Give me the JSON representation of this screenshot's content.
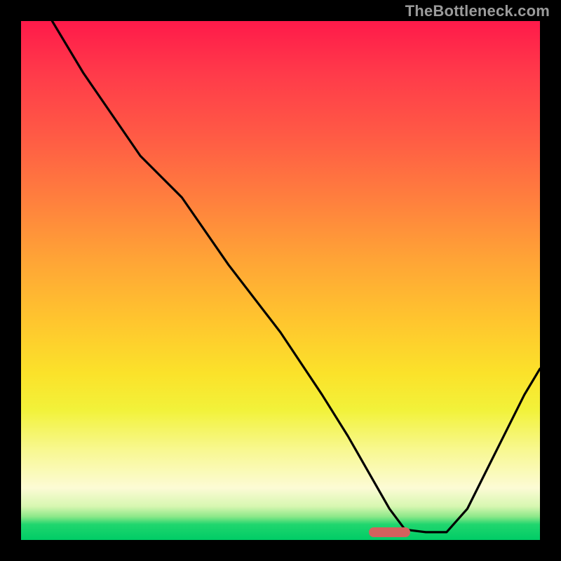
{
  "watermark": "TheBottleneck.com",
  "chart_data": {
    "type": "line",
    "title": "",
    "xlabel": "",
    "ylabel": "",
    "xlim": [
      0,
      100
    ],
    "ylim": [
      0,
      100
    ],
    "grid": false,
    "legend": false,
    "series": [
      {
        "name": "curve",
        "x": [
          6,
          12,
          23,
          31,
          40,
          50,
          58,
          63,
          67,
          71,
          74,
          78,
          82,
          86,
          90,
          94,
          97,
          100
        ],
        "values": [
          100,
          90,
          74,
          66,
          53,
          40,
          28,
          20,
          13,
          6,
          2,
          1.5,
          1.5,
          6,
          14,
          22,
          28,
          33
        ]
      }
    ],
    "marker": {
      "x_start": 67,
      "x_end": 75,
      "y": 1.5
    },
    "gradient_stops": [
      {
        "pos": 0,
        "color": "#ff1a4a"
      },
      {
        "pos": 0.46,
        "color": "#ffa436"
      },
      {
        "pos": 0.75,
        "color": "#f2f23a"
      },
      {
        "pos": 1.0,
        "color": "#00cc66"
      }
    ]
  }
}
